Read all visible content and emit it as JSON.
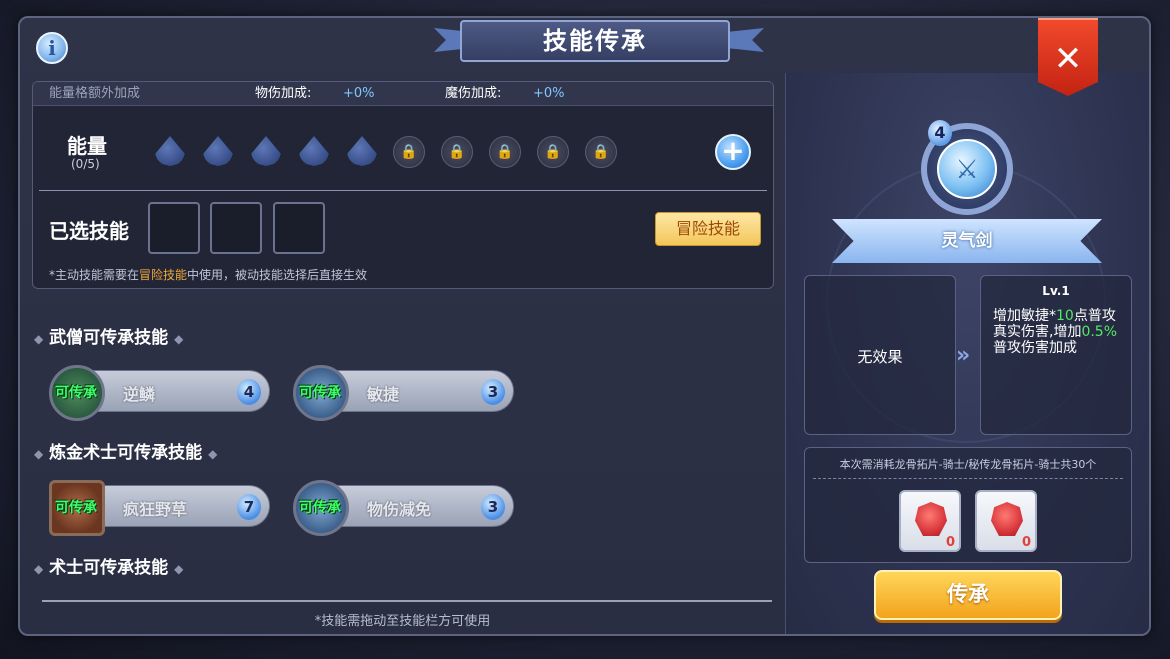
{
  "window": {
    "title": "技能传承",
    "close_icon": "close-icon",
    "info_icon": "info-icon"
  },
  "energy_panel": {
    "extra_bonus_label": "能量格额外加成",
    "physical_label": "物伤加成:",
    "physical_value": "+0%",
    "magic_label": "魔伤加成:",
    "magic_value": "+0%",
    "energy_label": "能量",
    "energy_count": "(0/5)",
    "selected_label": "已选技能",
    "adventure_button": "冒险技能",
    "note_prefix": "*主动技能需要在",
    "note_highlight": "冒险技能",
    "note_suffix": "中使用，被动技能选择后直接生效"
  },
  "sections": [
    {
      "title": "武僧可传承技能",
      "skills": [
        {
          "tag": "可传承",
          "name": "逆鳞",
          "cost": "4",
          "icon": "dragon-scale-icon"
        },
        {
          "tag": "可传承",
          "name": "敏捷",
          "cost": "3",
          "icon": "crystal-icon"
        }
      ]
    },
    {
      "title": "炼金术士可传承技能",
      "skills": [
        {
          "tag": "可传承",
          "name": "疯狂野草",
          "cost": "7",
          "icon": "wild-grass-icon"
        },
        {
          "tag": "可传承",
          "name": "物伤减免",
          "cost": "3",
          "icon": "crystal-icon"
        }
      ]
    },
    {
      "title": "术士可传承技能",
      "skills": []
    }
  ],
  "bottom_hint": "*技能需拖动至技能栏方可使用",
  "detail": {
    "skill_level_badge": "4",
    "skill_icon": "spirit-sword-icon",
    "skill_name": "灵气剑",
    "current_effect": "无效果",
    "next_level": "Lv.1",
    "effect_part1": "增加敏捷*",
    "effect_value1": "10",
    "effect_part2": "点普攻真实伤害,增加",
    "effect_value2": "0.5%",
    "effect_part3": "普攻伤害加成",
    "cost_text": "本次需消耗龙骨拓片-骑士/秘传龙骨拓片-骑士共30个",
    "items": [
      {
        "icon": "dragon-bone-rubbing-icon",
        "count": "0"
      },
      {
        "icon": "secret-dragon-bone-rubbing-icon",
        "count": "0"
      }
    ],
    "inherit_button": "传承"
  },
  "colors": {
    "accent_blue": "#7fc7ff",
    "highlight_orange": "#f2a93a",
    "effect_green": "#54e864",
    "close_red": "#e0402a",
    "button_gold": "#f2a31c"
  }
}
